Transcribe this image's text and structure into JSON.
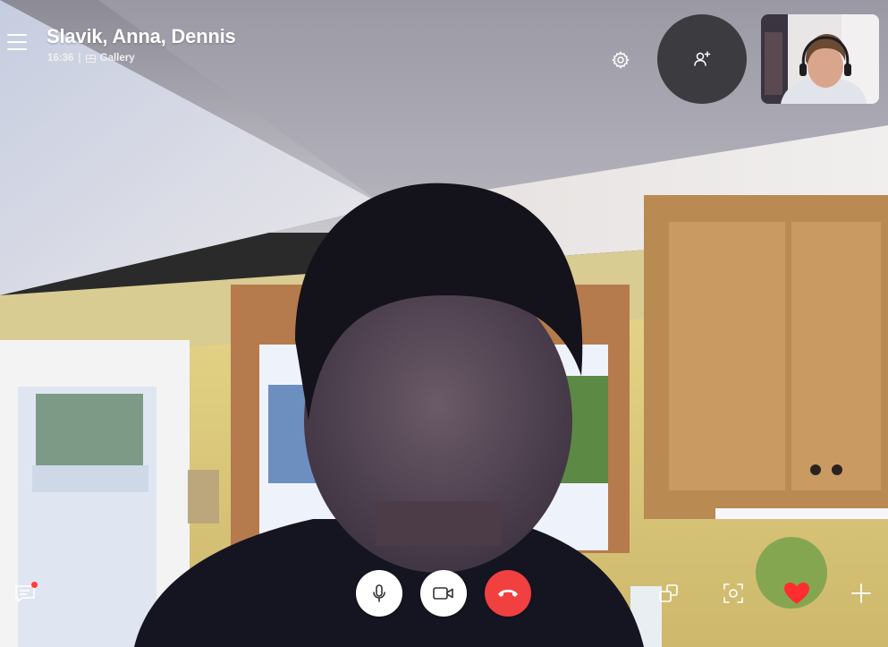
{
  "header": {
    "title": "Slavik, Anna, Dennis",
    "duration": "16:36",
    "separator": "|",
    "view_mode": "Gallery"
  },
  "colors": {
    "hangup_red": "#f04040",
    "notification_dot": "#ff3b3b",
    "add_people_bg": "#3c3b40",
    "reaction_heart": "#ff2d2d"
  },
  "icons": {
    "menu": "hamburger-menu-icon",
    "gallery": "gallery-icon",
    "settings": "gear-icon",
    "add_people": "add-person-icon",
    "chat": "chat-icon",
    "mic": "microphone-icon",
    "video": "video-camera-icon",
    "hangup": "hang-up-icon",
    "switch": "switch-view-icon",
    "snapshot": "snapshot-icon",
    "heart": "heart-icon",
    "more": "plus-icon"
  }
}
